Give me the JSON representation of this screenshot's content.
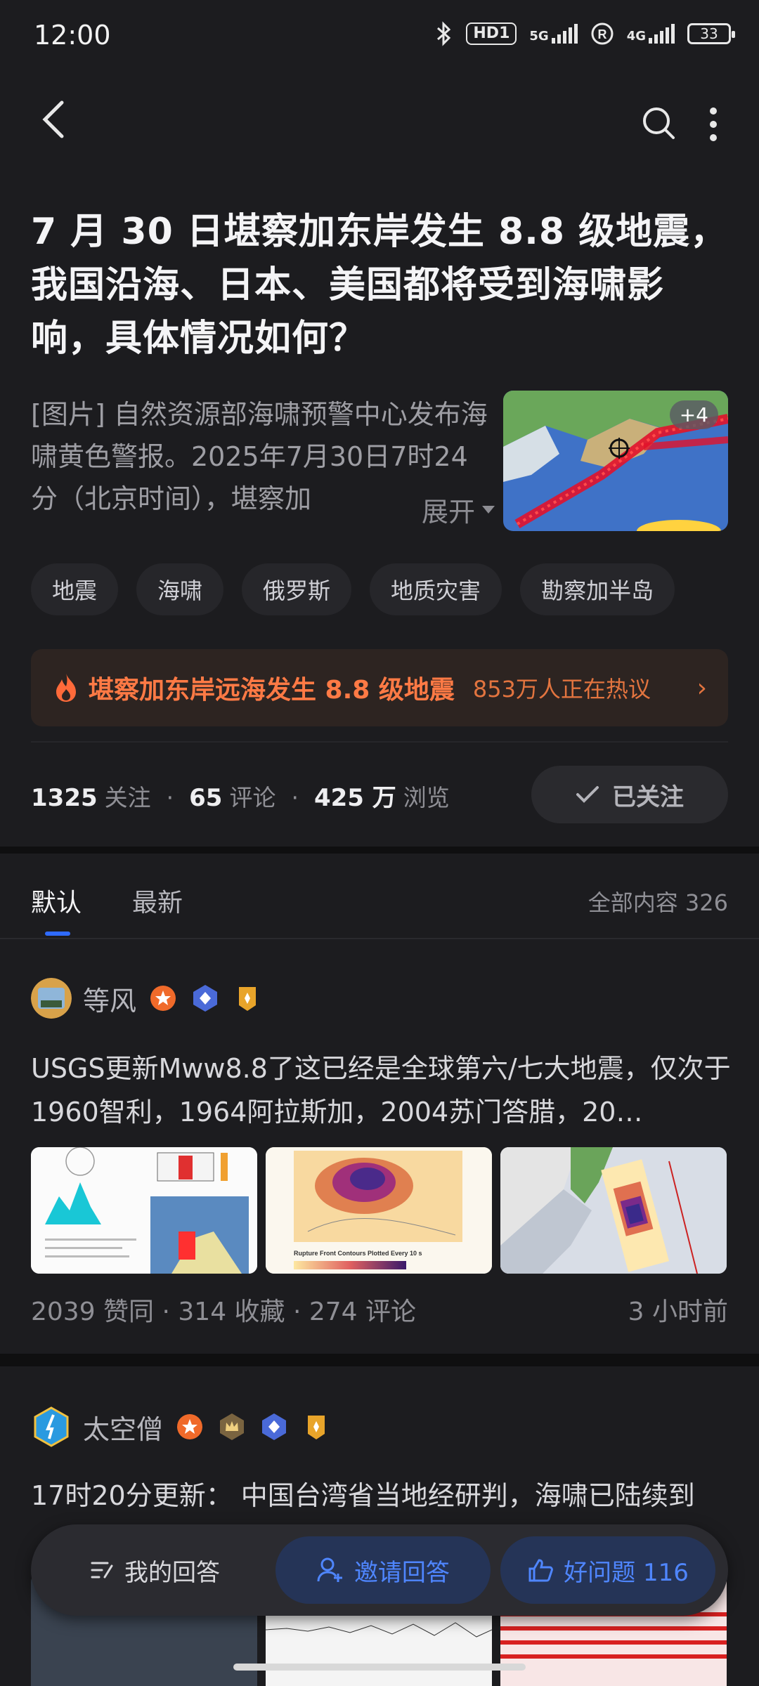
{
  "status": {
    "time": "12:00",
    "hd": "HD1",
    "net1": "5G",
    "net2": "4G",
    "battery": "33"
  },
  "question": {
    "title": "7 月 30 日堪察加东岸发生 8.8 级地震，我国沿海、日本、美国都将受到海啸影响，具体情况如何？",
    "description": "[图片] 自然资源部海啸预警中心发布海啸黄色警报。2025年7月30日7时24分（北京时间），堪察加",
    "expand_label": "展开",
    "image_more": "+4",
    "tags": [
      "地震",
      "海啸",
      "俄罗斯",
      "地质灾害",
      "勘察加半岛"
    ],
    "hot": {
      "text": "堪察加东岸远海发生 8.8 级地震",
      "count": "853万人正在热议",
      "arrow": "›"
    },
    "stats": {
      "follow_count": "1325",
      "follow_label": "关注",
      "comment_count": "65",
      "comment_label": "评论",
      "view_count": "425 万",
      "view_label": "浏览"
    },
    "follow_button": "已关注"
  },
  "tabs": {
    "default": "默认",
    "latest": "最新",
    "all_content": "全部内容 326"
  },
  "answers": [
    {
      "author": "等风",
      "text": "USGS更新Mww8.8了这已经是全球第六/七大地震，仅次于1960智利，1964阿拉斯加，2004苏门答腊，20…",
      "stats": "2039 赞同 · 314 收藏 · 274 评论",
      "time": "3 小时前",
      "img2_caption": "Rupture Front Contours Plotted Every 10 s"
    },
    {
      "author": "太空僧",
      "text": "17时20分更新： 中国台湾省当地经研判，海啸已陆续到"
    }
  ],
  "bottom": {
    "my_answer": "我的回答",
    "invite": "邀请回答",
    "good_q": "好问题 116"
  },
  "colors": {
    "accent": "#2f6bff",
    "hot": "#ff7a45",
    "bg": "#1c1c1f"
  }
}
